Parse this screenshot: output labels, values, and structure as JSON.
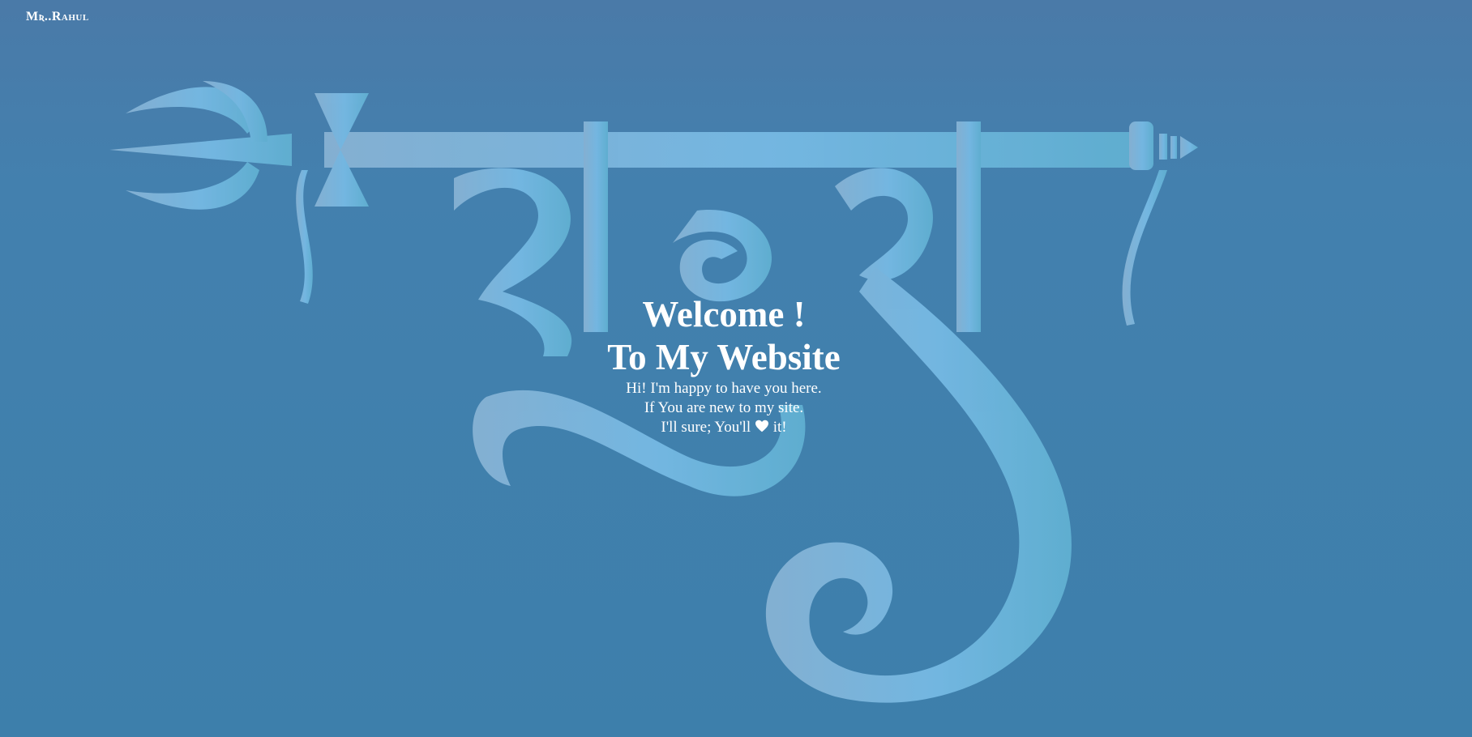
{
  "header": {
    "brand_label": "Mʀ..Rahul"
  },
  "hero": {
    "title_line1": "Welcome !",
    "title_line2": "To My Website",
    "line1": "Hi! I'm happy to have you here.",
    "line2": "If You are new to my site.",
    "line3_before": "I'll sure; You'll",
    "line3_after": "it!",
    "heart_icon": "heart-icon"
  },
  "background": {
    "art_text": "राहुल",
    "colors": {
      "background": "#3d7fab",
      "art": "#7bbbe3",
      "text": "#ffffff"
    }
  }
}
